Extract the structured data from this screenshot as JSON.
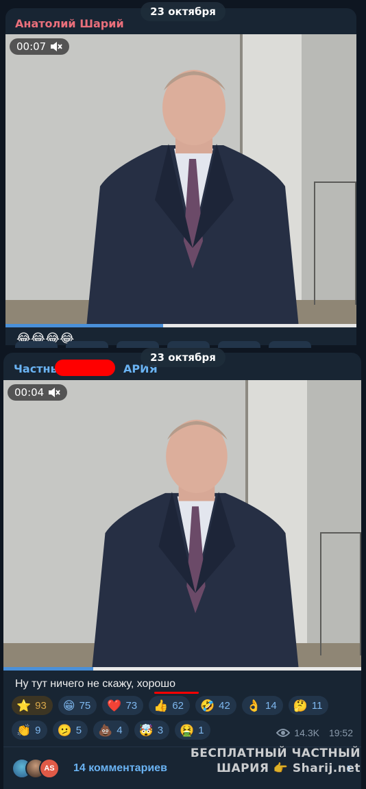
{
  "colors": {
    "background": "#0e1621",
    "bubble": "#182533",
    "sender1": "#ea6f7b",
    "sender2": "#6ab3f3",
    "accent": "#6ab3f3",
    "redaction": "#ff0000"
  },
  "post1": {
    "date": "23 октября",
    "sender": "Анатолий Шарий",
    "video_time": "00:07",
    "progress": 0.45,
    "caption_emoji": "😂😂😂😂"
  },
  "post2": {
    "date": "23 октября",
    "sender_start": "Частны",
    "sender_end": "АРИЯ",
    "video_time": "00:04",
    "progress": 0.25,
    "caption": "Ну тут ничего не скажу, хорошо",
    "reactions": [
      {
        "emoji": "⭐",
        "count": "93",
        "icon": "star-icon",
        "starred": true
      },
      {
        "emoji": "😁",
        "count": "75",
        "icon": "grin-icon"
      },
      {
        "emoji": "❤️",
        "count": "73",
        "icon": "heart-icon"
      },
      {
        "emoji": "👍",
        "count": "62",
        "icon": "thumbs-up-icon"
      },
      {
        "emoji": "🤣",
        "count": "42",
        "icon": "rofl-icon"
      },
      {
        "emoji": "👌",
        "count": "14",
        "icon": "ok-hand-icon"
      },
      {
        "emoji": "🤔",
        "count": "11",
        "icon": "thinking-icon"
      },
      {
        "emoji": "👏",
        "count": "9",
        "icon": "clap-icon"
      },
      {
        "emoji": "🫤",
        "count": "5",
        "icon": "confused-icon"
      },
      {
        "emoji": "💩",
        "count": "4",
        "icon": "poo-icon"
      },
      {
        "emoji": "🤯",
        "count": "3",
        "icon": "mind-blown-icon"
      },
      {
        "emoji": "🤮",
        "count": "1",
        "icon": "vomit-icon"
      }
    ],
    "views": "14.3K",
    "time": "19:52",
    "comments_label": "14 комментариев",
    "avatar3_initials": "AS"
  },
  "watermark": {
    "line1": "БЕСПЛАТНЫЙ ЧАСТНЫЙ",
    "line2_word": "ШАРИЯ",
    "line2_site": "Sharij.net"
  }
}
